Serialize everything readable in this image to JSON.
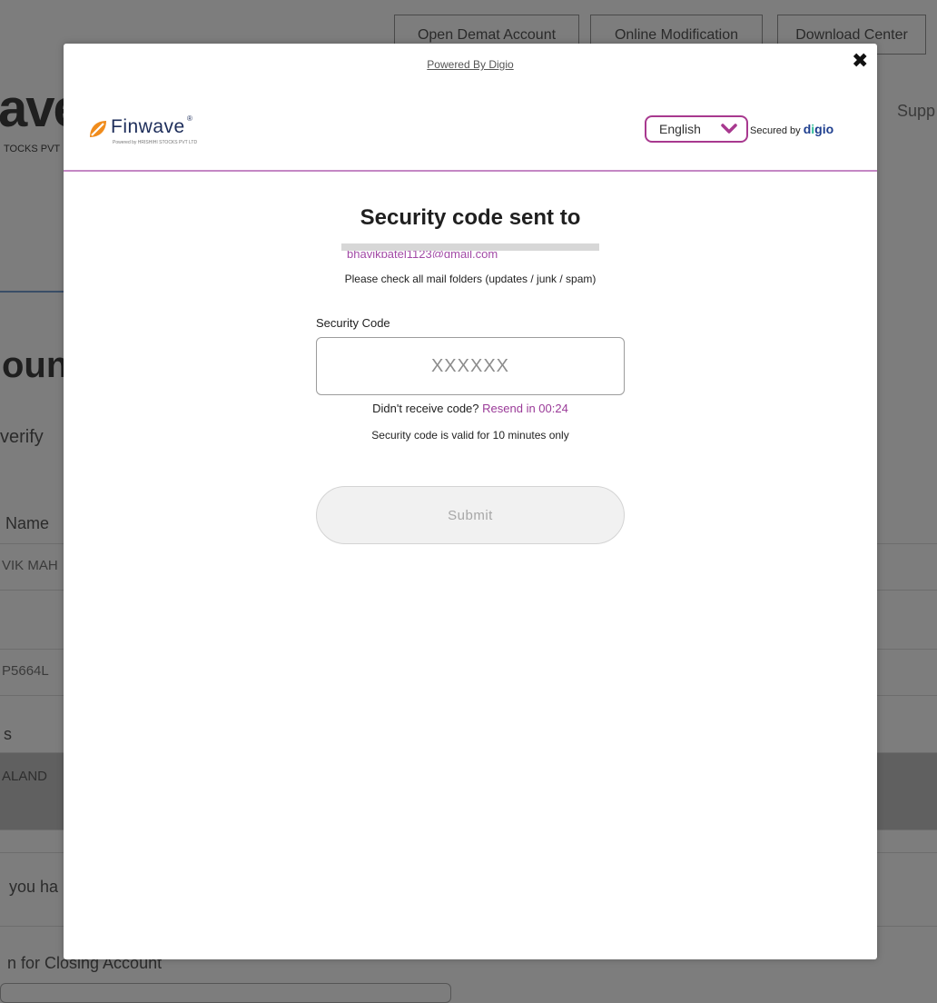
{
  "background": {
    "top_nav": [
      "Open Demat Account",
      "Online Modification",
      "Download Center"
    ],
    "logo_fragment": "ave",
    "logo_sub_fragment": "TOCKS PVT",
    "support_fragment": "Supp",
    "heading_fragment": "oun",
    "subtitle_fragment": "verify",
    "name_label_fragment": "Name",
    "name_value_fragment": "VIK MAH",
    "pan_value_fragment": "P5664L",
    "address_label_fragment": "s",
    "address_value_fragment": "ALAND",
    "question_fragment": "you ha",
    "reason_label_fragment": "n for Closing Account"
  },
  "modal": {
    "powered_by": "Powered By Digio",
    "close_symbol": "✖",
    "brand": {
      "name": "Finwave",
      "registered": "®",
      "subline": "Powered by HRISHIHI STOCKS PVT LTD"
    },
    "language": {
      "selected": "English",
      "chevron_icon": "chevron-down-icon"
    },
    "secured_by": {
      "prefix": "Secured by",
      "brand_d": "d",
      "brand_i": "i",
      "brand_rest": "gio"
    },
    "title": "Security code sent to",
    "masked_email": "bhavikpatel1123@gmail.com",
    "hint": "Please check all mail folders (updates / junk / spam)",
    "code_field": {
      "label": "Security Code",
      "placeholder": "XXXXXX",
      "value": ""
    },
    "resend": {
      "prompt": "Didn't receive code?",
      "link": "Resend in 00:24"
    },
    "validity": "Security code is valid for 10 minutes only",
    "submit_label": "Submit"
  },
  "colors": {
    "accent": "#a8398f",
    "accent_link": "#9a3a98",
    "overlay": "#7d7d7d",
    "header_rule": "#c487c4"
  }
}
